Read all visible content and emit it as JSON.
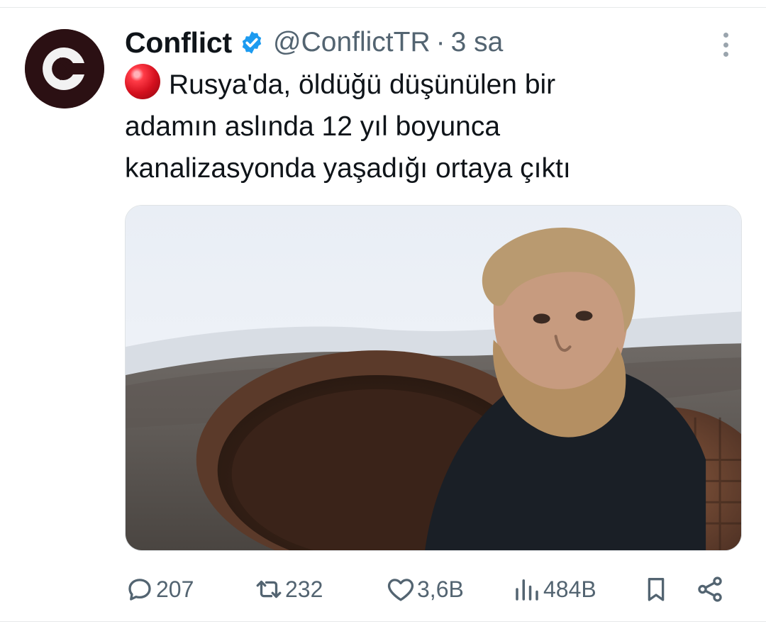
{
  "tweet": {
    "author_name": "Conflict",
    "handle": "@ConflictTR",
    "separator": "·",
    "time": "3 sa",
    "text_lines": [
      "Rusya'da, öldüğü düşünülen bir",
      "adamın aslında 12 yıl boyunca",
      "kanalizasyonda yaşadığı ortaya çıktı"
    ],
    "emoji": "red-circle",
    "image_alt": "Bearded man emerging from a manhole in snow"
  },
  "stats": {
    "replies": "207",
    "reposts": "232",
    "likes": "3,6B",
    "views": "484B"
  },
  "icons": {
    "verified": "verified-badge-icon",
    "more": "more-vertical-icon",
    "reply": "reply-icon",
    "repost": "repost-icon",
    "like": "heart-icon",
    "views": "views-icon",
    "bookmark": "bookmark-icon",
    "share": "share-icon"
  },
  "colors": {
    "verified_blue": "#1d9bf0",
    "text_primary": "#0f1419",
    "text_secondary": "#536471"
  }
}
